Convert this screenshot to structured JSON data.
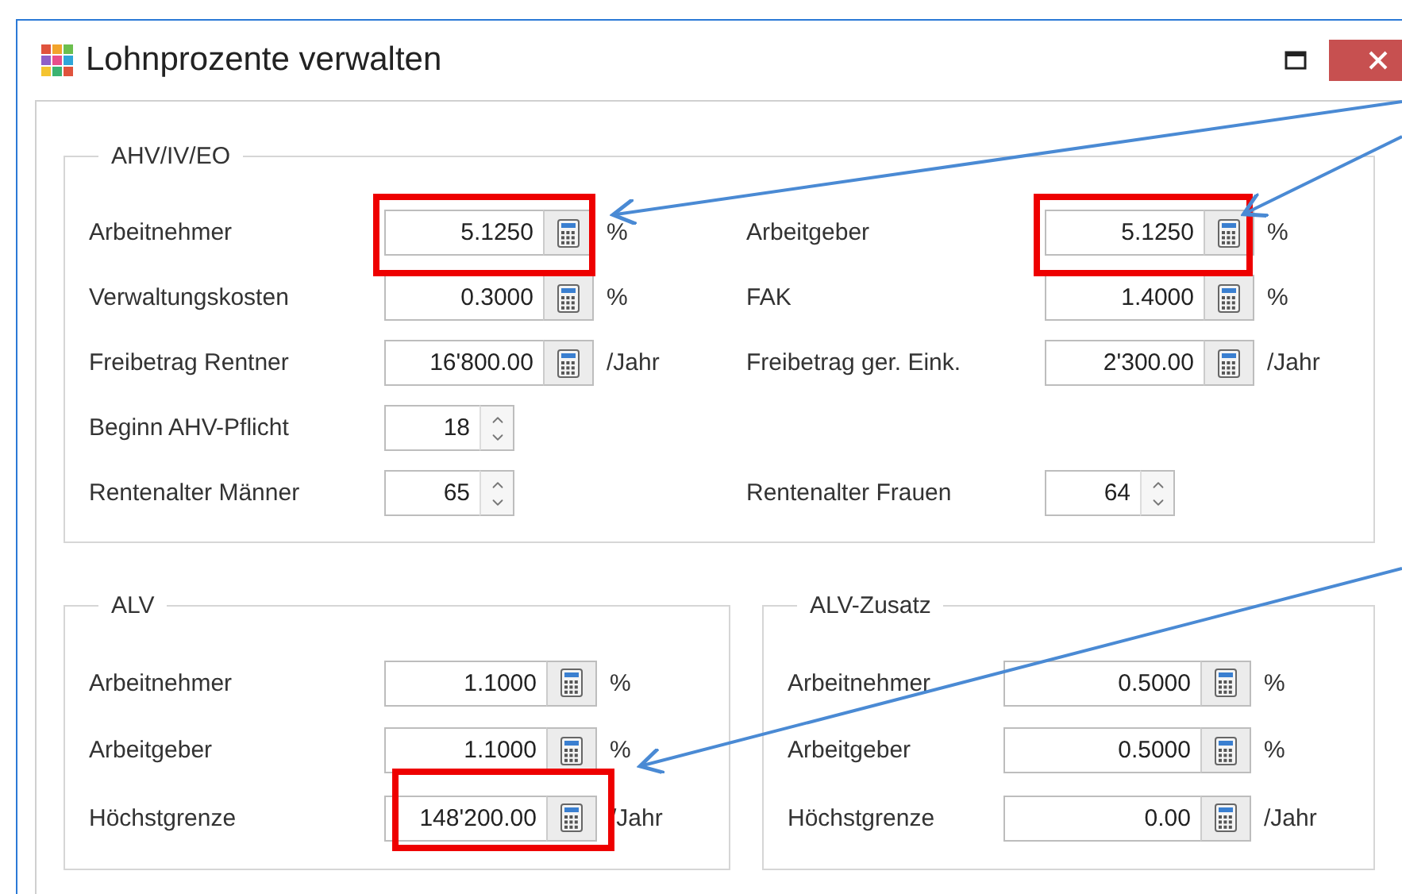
{
  "window": {
    "title": "Lohnprozente verwalten"
  },
  "ahv": {
    "title": "AHV/IV/EO",
    "rows": [
      {
        "left": {
          "label": "Arbeitnehmer",
          "value": "5.1250",
          "kind": "calc",
          "unit": "%"
        },
        "right": {
          "label": "Arbeitgeber",
          "value": "5.1250",
          "kind": "calc",
          "unit": "%"
        }
      },
      {
        "left": {
          "label": "Verwaltungskosten",
          "value": "0.3000",
          "kind": "calc",
          "unit": "%"
        },
        "right": {
          "label": "FAK",
          "value": "1.4000",
          "kind": "calc",
          "unit": "%"
        }
      },
      {
        "left": {
          "label": "Freibetrag Rentner",
          "value": "16'800.00",
          "kind": "calc",
          "unit": "/Jahr"
        },
        "right": {
          "label": "Freibetrag ger. Eink.",
          "value": "2'300.00",
          "kind": "calc",
          "unit": "/Jahr"
        }
      },
      {
        "left": {
          "label": "Beginn AHV-Pflicht",
          "value": "18",
          "kind": "spin"
        }
      },
      {
        "left": {
          "label": "Rentenalter Männer",
          "value": "65",
          "kind": "spin"
        },
        "right": {
          "label": "Rentenalter Frauen",
          "value": "64",
          "kind": "spin"
        }
      }
    ]
  },
  "alv": {
    "title": "ALV",
    "rows": [
      {
        "label": "Arbeitnehmer",
        "value": "1.1000",
        "kind": "calc",
        "unit": "%"
      },
      {
        "label": "Arbeitgeber",
        "value": "1.1000",
        "kind": "calc",
        "unit": "%"
      },
      {
        "label": "Höchstgrenze",
        "value": "148'200.00",
        "kind": "calc",
        "unit": "/Jahr"
      }
    ]
  },
  "alv_zusatz": {
    "title": "ALV-Zusatz",
    "rows": [
      {
        "label": "Arbeitnehmer",
        "value": "0.5000",
        "kind": "calc",
        "unit": "%"
      },
      {
        "label": "Arbeitgeber",
        "value": "0.5000",
        "kind": "calc",
        "unit": "%"
      },
      {
        "label": "Höchstgrenze",
        "value": "0.00",
        "kind": "calc",
        "unit": "/Jahr"
      }
    ]
  }
}
